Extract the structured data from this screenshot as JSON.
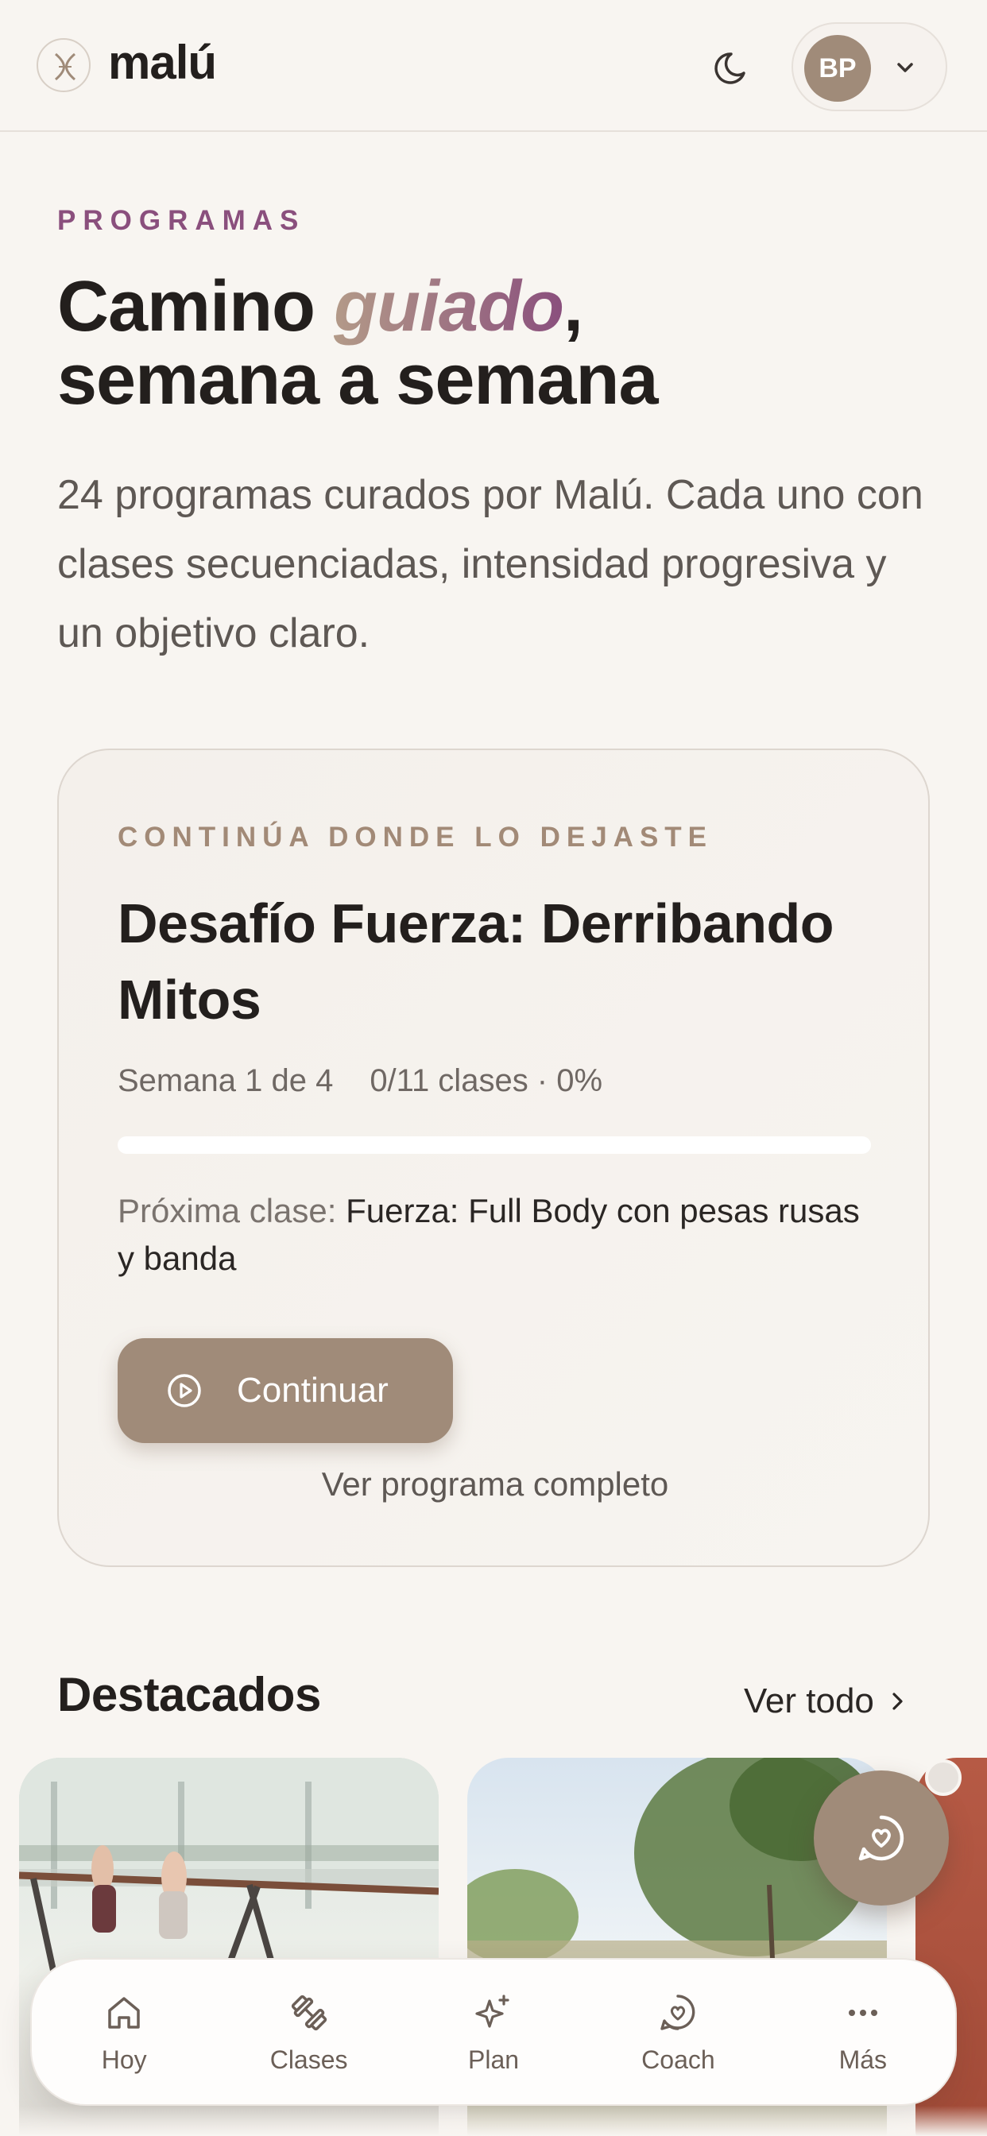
{
  "header": {
    "brand": "malú",
    "user_initials": "BP"
  },
  "hero": {
    "eyebrow": "PROGRAMAS",
    "title_part1": "Camino ",
    "title_accent": "guiado",
    "title_part2": ",",
    "title_line2": "semana a semana",
    "subtitle": "24 programas curados por Malú. Cada uno con clases secuenciadas, intensidad progresiva y un objetivo claro."
  },
  "continue_card": {
    "eyebrow": "CONTINÚA DONDE LO DEJASTE",
    "title": "Desafío Fuerza: Derribando Mitos",
    "week": "Semana 1 de 4",
    "classes": "0/11 clases · 0%",
    "progress_percent": 0,
    "next_label": "Próxima clase: ",
    "next_value": "Fuerza: Full Body con pesas rusas y banda",
    "continue_label": "Continuar",
    "see_program_label": "Ver programa completo"
  },
  "featured": {
    "title": "Destacados",
    "see_all_label": "Ver todo"
  },
  "bottom_nav": {
    "items": [
      {
        "label": "Hoy",
        "icon": "home-icon"
      },
      {
        "label": "Clases",
        "icon": "dumbbell-icon"
      },
      {
        "label": "Plan",
        "icon": "sparkles-icon"
      },
      {
        "label": "Coach",
        "icon": "chat-heart-icon"
      },
      {
        "label": "Más",
        "icon": "more-icon"
      }
    ]
  },
  "colors": {
    "accent": "#a08b79",
    "brand_purple": "#8a4f7d",
    "background": "#f8f5f1"
  }
}
